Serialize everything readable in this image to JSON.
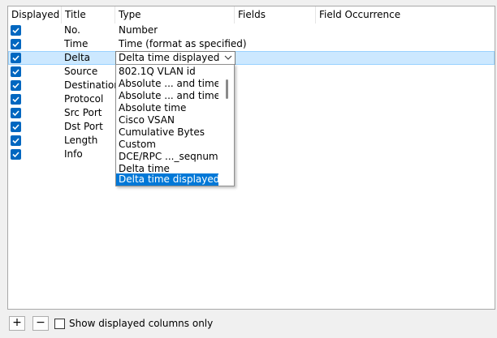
{
  "table": {
    "headers": [
      "Displayed",
      "Title",
      "Type",
      "Fields",
      "Field Occurrence"
    ],
    "rows": [
      {
        "displayed": true,
        "title": "No.",
        "type": "Number"
      },
      {
        "displayed": true,
        "title": "Time",
        "type": "Time (format as specified)"
      },
      {
        "displayed": true,
        "title": "Delta",
        "type": "Delta time displayed"
      },
      {
        "displayed": true,
        "title": "Source",
        "type": ""
      },
      {
        "displayed": true,
        "title": "Destination",
        "type": ""
      },
      {
        "displayed": true,
        "title": "Protocol",
        "type": ""
      },
      {
        "displayed": true,
        "title": "Src Port",
        "type": ""
      },
      {
        "displayed": true,
        "title": "Dst Port",
        "type": ""
      },
      {
        "displayed": true,
        "title": "Length",
        "type": ""
      },
      {
        "displayed": true,
        "title": "Info",
        "type": ""
      }
    ],
    "selected_row": 2
  },
  "type_dropdown": {
    "selected_value": "Delta time displayed",
    "options": [
      "802.1Q VLAN id",
      "Absolute ... and time",
      "Absolute ... and time",
      "Absolute time",
      "Cisco VSAN",
      "Cumulative Bytes",
      "Custom",
      "DCE/RPC ..._seqnum)",
      "Delta time",
      "Delta time displayed"
    ],
    "highlighted_index": 9
  },
  "bottom_bar": {
    "add_label": "+",
    "remove_label": "−",
    "show_displayed_only_label": "Show displayed columns only",
    "show_displayed_only_checked": false
  },
  "colors": {
    "checkbox_checked": "#0067c0",
    "row_selected": "#cce8ff",
    "dropdown_highlight": "#0078d7"
  },
  "icons": {
    "checkbox": "checkmark-icon",
    "combo_arrow": "chevron-down-icon"
  }
}
